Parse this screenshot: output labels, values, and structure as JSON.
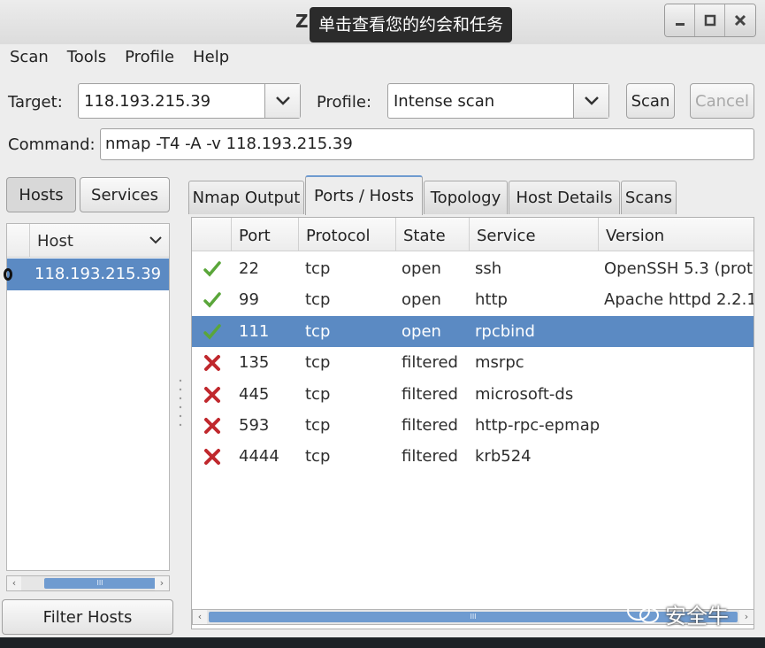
{
  "window": {
    "title_fragment": "Z",
    "tooltip": "单击查看您的约会和任务"
  },
  "window_controls": [
    "minimize",
    "maximize",
    "close"
  ],
  "menu": [
    "Scan",
    "Tools",
    "Profile",
    "Help"
  ],
  "target": {
    "label": "Target:",
    "value": "118.193.215.39"
  },
  "profile": {
    "label": "Profile:",
    "value": "Intense scan"
  },
  "buttons": {
    "scan": "Scan",
    "cancel": "Cancel",
    "filter_hosts": "Filter Hosts"
  },
  "command": {
    "label": "Command:",
    "value": "nmap -T4 -A -v 118.193.215.39"
  },
  "view_toggle": {
    "hosts": "Hosts",
    "services": "Services"
  },
  "host_list": {
    "header": "Host",
    "hosts": [
      "118.193.215.39"
    ]
  },
  "tabs": [
    "Nmap Output",
    "Ports / Hosts",
    "Topology",
    "Host Details",
    "Scans"
  ],
  "ports_table": {
    "columns": [
      "Port",
      "Protocol",
      "State",
      "Service",
      "Version"
    ],
    "rows": [
      {
        "status_icon": "check-icon",
        "port": "22",
        "protocol": "tcp",
        "state": "open",
        "service": "ssh",
        "version": "OpenSSH 5.3 (prot"
      },
      {
        "status_icon": "check-icon",
        "port": "99",
        "protocol": "tcp",
        "state": "open",
        "service": "http",
        "version": "Apache httpd 2.2.1"
      },
      {
        "status_icon": "check-icon",
        "port": "111",
        "protocol": "tcp",
        "state": "open",
        "service": "rpcbind",
        "version": ""
      },
      {
        "status_icon": "cross-icon",
        "port": "135",
        "protocol": "tcp",
        "state": "filtered",
        "service": "msrpc",
        "version": ""
      },
      {
        "status_icon": "cross-icon",
        "port": "445",
        "protocol": "tcp",
        "state": "filtered",
        "service": "microsoft-ds",
        "version": ""
      },
      {
        "status_icon": "cross-icon",
        "port": "593",
        "protocol": "tcp",
        "state": "filtered",
        "service": "http-rpc-epmap",
        "version": ""
      },
      {
        "status_icon": "cross-icon",
        "port": "4444",
        "protocol": "tcp",
        "state": "filtered",
        "service": "krb524",
        "version": ""
      }
    ],
    "selected_row": 2
  },
  "scrollbar_grip": "III",
  "watermark": "安全牛",
  "colors": {
    "selection": "#5b8ac3",
    "check": "#5aa63a",
    "cross": "#c0282d",
    "background": "#ededed"
  }
}
